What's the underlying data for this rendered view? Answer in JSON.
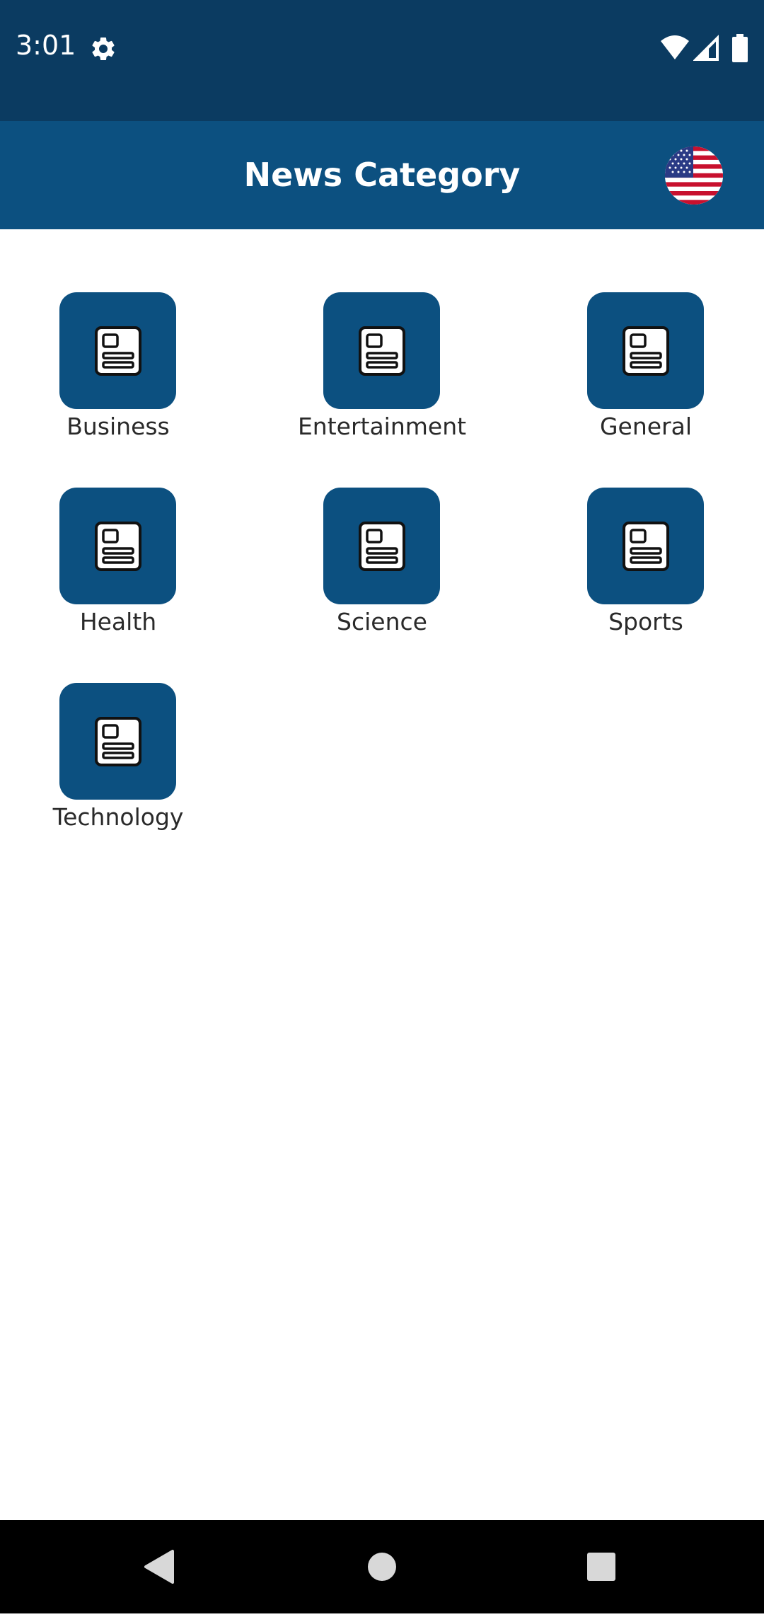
{
  "status_bar": {
    "time": "3:01",
    "icons": [
      "gear-icon",
      "wifi-icon",
      "signal-icon",
      "battery-icon"
    ]
  },
  "app_bar": {
    "title": "News Category",
    "country_icon": "us-flag-icon"
  },
  "categories": [
    {
      "label": "Business",
      "icon": "newspaper-icon"
    },
    {
      "label": "Entertainment",
      "icon": "newspaper-icon"
    },
    {
      "label": "General",
      "icon": "newspaper-icon"
    },
    {
      "label": "Health",
      "icon": "newspaper-icon"
    },
    {
      "label": "Science",
      "icon": "newspaper-icon"
    },
    {
      "label": "Sports",
      "icon": "newspaper-icon"
    },
    {
      "label": "Technology",
      "icon": "newspaper-icon"
    }
  ],
  "nav_bar": {
    "buttons": [
      "back-icon",
      "home-icon",
      "recents-icon"
    ]
  },
  "colors": {
    "status_bar": "#0b3b61",
    "app_bar": "#0c5080",
    "tile": "#0c5080",
    "background": "#ffffff"
  }
}
